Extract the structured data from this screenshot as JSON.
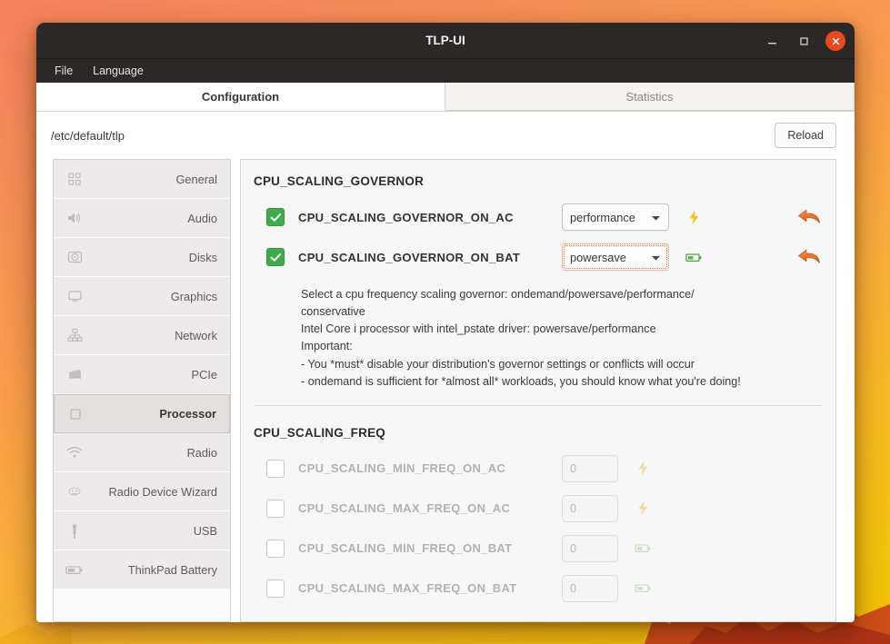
{
  "window": {
    "title": "TLP-UI",
    "controls": {
      "minimize": "minimize-icon",
      "maximize": "maximize-icon",
      "close": "close-icon"
    }
  },
  "menubar": {
    "items": [
      {
        "label": "File"
      },
      {
        "label": "Language"
      }
    ]
  },
  "tabs": [
    {
      "label": "Configuration",
      "active": true
    },
    {
      "label": "Statistics",
      "active": false
    }
  ],
  "toolbar": {
    "path": "/etc/default/tlp",
    "reload_label": "Reload"
  },
  "sidebar": {
    "items": [
      {
        "label": "General",
        "icon": "apps-grid-icon",
        "selected": false
      },
      {
        "label": "Audio",
        "icon": "speaker-icon",
        "selected": false
      },
      {
        "label": "Disks",
        "icon": "harddisk-icon",
        "selected": false
      },
      {
        "label": "Graphics",
        "icon": "monitor-icon",
        "selected": false
      },
      {
        "label": "Network",
        "icon": "network-tree-icon",
        "selected": false
      },
      {
        "label": "PCIe",
        "icon": "pcie-card-icon",
        "selected": false
      },
      {
        "label": "Processor",
        "icon": "chip-icon",
        "selected": true
      },
      {
        "label": "Radio",
        "icon": "wifi-icon",
        "selected": false
      },
      {
        "label": "Radio Device Wizard",
        "icon": "wizard-icon",
        "selected": false
      },
      {
        "label": "USB",
        "icon": "usb-icon",
        "selected": false
      },
      {
        "label": "ThinkPad Battery",
        "icon": "battery-icon",
        "selected": false
      }
    ]
  },
  "main": {
    "groups": [
      {
        "title": "CPU_SCALING_GOVERNOR",
        "rows": [
          {
            "label": "CPU_SCALING_GOVERNOR_ON_AC",
            "checked": true,
            "control": "select",
            "value": "performance",
            "power": "ac-bolt-icon",
            "undo": "undo-arrow-icon",
            "focused": false
          },
          {
            "label": "CPU_SCALING_GOVERNOR_ON_BAT",
            "checked": true,
            "control": "select",
            "value": "powersave",
            "power": "battery-icon",
            "undo": "undo-arrow-icon",
            "focused": true
          }
        ],
        "description": "Select a cpu frequency scaling governor: ondemand/powersave/performance/\nconservative\nIntel Core i processor with intel_pstate driver: powersave/performance\nImportant:\n- You *must* disable your distribution's governor settings or conflicts will occur\n- ondemand is sufficient for *almost all* workloads, you should know what you're doing!"
      },
      {
        "title": "CPU_SCALING_FREQ",
        "rows": [
          {
            "label": "CPU_SCALING_MIN_FREQ_ON_AC",
            "checked": false,
            "control": "spin",
            "value": "0",
            "power": "ac-bolt-icon",
            "undo": null,
            "disabled": true
          },
          {
            "label": "CPU_SCALING_MAX_FREQ_ON_AC",
            "checked": false,
            "control": "spin",
            "value": "0",
            "power": "ac-bolt-icon",
            "undo": null,
            "disabled": true
          },
          {
            "label": "CPU_SCALING_MIN_FREQ_ON_BAT",
            "checked": false,
            "control": "spin",
            "value": "0",
            "power": "battery-icon",
            "undo": null,
            "disabled": true
          },
          {
            "label": "CPU_SCALING_MAX_FREQ_ON_BAT",
            "checked": false,
            "control": "spin",
            "value": "0",
            "power": "battery-icon",
            "undo": null,
            "disabled": true
          }
        ],
        "description": ""
      }
    ]
  },
  "colors": {
    "accent_orange": "#e8491f",
    "checkbox_green": "#3fab4b",
    "undo_orange": "#e06a22",
    "bolt_yellow": "#f2c40e",
    "titlebar": "#2b2827"
  }
}
